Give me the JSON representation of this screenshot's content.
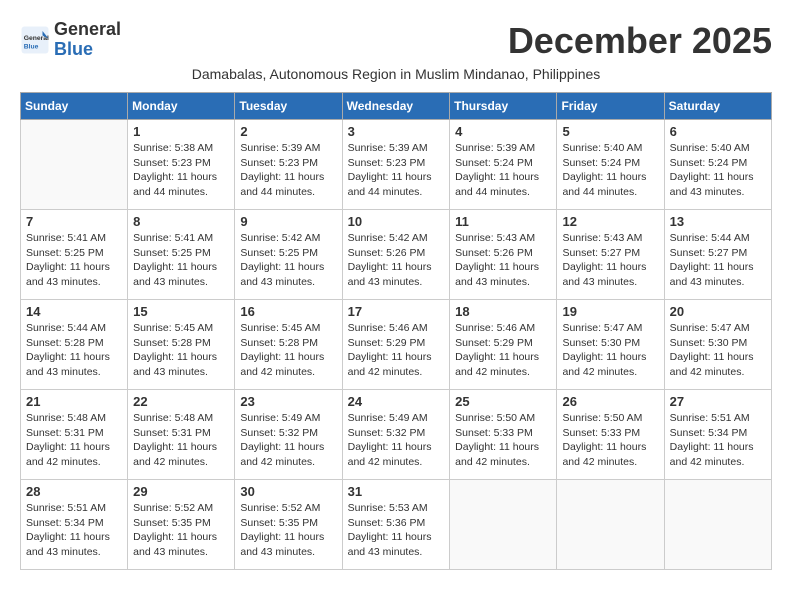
{
  "header": {
    "logo_general": "General",
    "logo_blue": "Blue",
    "month_title": "December 2025",
    "subtitle": "Damabalas, Autonomous Region in Muslim Mindanao, Philippines"
  },
  "weekdays": [
    "Sunday",
    "Monday",
    "Tuesday",
    "Wednesday",
    "Thursday",
    "Friday",
    "Saturday"
  ],
  "weeks": [
    [
      {
        "day": "",
        "info": ""
      },
      {
        "day": "1",
        "info": "Sunrise: 5:38 AM\nSunset: 5:23 PM\nDaylight: 11 hours and 44 minutes."
      },
      {
        "day": "2",
        "info": "Sunrise: 5:39 AM\nSunset: 5:23 PM\nDaylight: 11 hours and 44 minutes."
      },
      {
        "day": "3",
        "info": "Sunrise: 5:39 AM\nSunset: 5:23 PM\nDaylight: 11 hours and 44 minutes."
      },
      {
        "day": "4",
        "info": "Sunrise: 5:39 AM\nSunset: 5:24 PM\nDaylight: 11 hours and 44 minutes."
      },
      {
        "day": "5",
        "info": "Sunrise: 5:40 AM\nSunset: 5:24 PM\nDaylight: 11 hours and 44 minutes."
      },
      {
        "day": "6",
        "info": "Sunrise: 5:40 AM\nSunset: 5:24 PM\nDaylight: 11 hours and 43 minutes."
      }
    ],
    [
      {
        "day": "7",
        "info": "Sunrise: 5:41 AM\nSunset: 5:25 PM\nDaylight: 11 hours and 43 minutes."
      },
      {
        "day": "8",
        "info": "Sunrise: 5:41 AM\nSunset: 5:25 PM\nDaylight: 11 hours and 43 minutes."
      },
      {
        "day": "9",
        "info": "Sunrise: 5:42 AM\nSunset: 5:25 PM\nDaylight: 11 hours and 43 minutes."
      },
      {
        "day": "10",
        "info": "Sunrise: 5:42 AM\nSunset: 5:26 PM\nDaylight: 11 hours and 43 minutes."
      },
      {
        "day": "11",
        "info": "Sunrise: 5:43 AM\nSunset: 5:26 PM\nDaylight: 11 hours and 43 minutes."
      },
      {
        "day": "12",
        "info": "Sunrise: 5:43 AM\nSunset: 5:27 PM\nDaylight: 11 hours and 43 minutes."
      },
      {
        "day": "13",
        "info": "Sunrise: 5:44 AM\nSunset: 5:27 PM\nDaylight: 11 hours and 43 minutes."
      }
    ],
    [
      {
        "day": "14",
        "info": "Sunrise: 5:44 AM\nSunset: 5:28 PM\nDaylight: 11 hours and 43 minutes."
      },
      {
        "day": "15",
        "info": "Sunrise: 5:45 AM\nSunset: 5:28 PM\nDaylight: 11 hours and 43 minutes."
      },
      {
        "day": "16",
        "info": "Sunrise: 5:45 AM\nSunset: 5:28 PM\nDaylight: 11 hours and 42 minutes."
      },
      {
        "day": "17",
        "info": "Sunrise: 5:46 AM\nSunset: 5:29 PM\nDaylight: 11 hours and 42 minutes."
      },
      {
        "day": "18",
        "info": "Sunrise: 5:46 AM\nSunset: 5:29 PM\nDaylight: 11 hours and 42 minutes."
      },
      {
        "day": "19",
        "info": "Sunrise: 5:47 AM\nSunset: 5:30 PM\nDaylight: 11 hours and 42 minutes."
      },
      {
        "day": "20",
        "info": "Sunrise: 5:47 AM\nSunset: 5:30 PM\nDaylight: 11 hours and 42 minutes."
      }
    ],
    [
      {
        "day": "21",
        "info": "Sunrise: 5:48 AM\nSunset: 5:31 PM\nDaylight: 11 hours and 42 minutes."
      },
      {
        "day": "22",
        "info": "Sunrise: 5:48 AM\nSunset: 5:31 PM\nDaylight: 11 hours and 42 minutes."
      },
      {
        "day": "23",
        "info": "Sunrise: 5:49 AM\nSunset: 5:32 PM\nDaylight: 11 hours and 42 minutes."
      },
      {
        "day": "24",
        "info": "Sunrise: 5:49 AM\nSunset: 5:32 PM\nDaylight: 11 hours and 42 minutes."
      },
      {
        "day": "25",
        "info": "Sunrise: 5:50 AM\nSunset: 5:33 PM\nDaylight: 11 hours and 42 minutes."
      },
      {
        "day": "26",
        "info": "Sunrise: 5:50 AM\nSunset: 5:33 PM\nDaylight: 11 hours and 42 minutes."
      },
      {
        "day": "27",
        "info": "Sunrise: 5:51 AM\nSunset: 5:34 PM\nDaylight: 11 hours and 42 minutes."
      }
    ],
    [
      {
        "day": "28",
        "info": "Sunrise: 5:51 AM\nSunset: 5:34 PM\nDaylight: 11 hours and 43 minutes."
      },
      {
        "day": "29",
        "info": "Sunrise: 5:52 AM\nSunset: 5:35 PM\nDaylight: 11 hours and 43 minutes."
      },
      {
        "day": "30",
        "info": "Sunrise: 5:52 AM\nSunset: 5:35 PM\nDaylight: 11 hours and 43 minutes."
      },
      {
        "day": "31",
        "info": "Sunrise: 5:53 AM\nSunset: 5:36 PM\nDaylight: 11 hours and 43 minutes."
      },
      {
        "day": "",
        "info": ""
      },
      {
        "day": "",
        "info": ""
      },
      {
        "day": "",
        "info": ""
      }
    ]
  ]
}
